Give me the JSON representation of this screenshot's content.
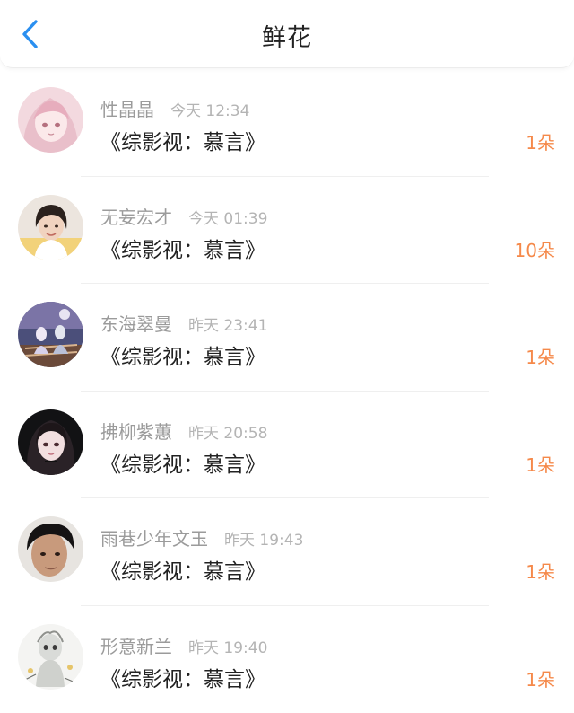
{
  "header": {
    "title": "鲜花",
    "back_icon": "chevron-left-icon",
    "accent": "#2a8ff0"
  },
  "colors": {
    "count": "#f5894a",
    "name": "#9b9b9b",
    "time": "#b4b4b4",
    "book": "#222222"
  },
  "records": [
    {
      "name": "性晶晶",
      "time": "今天 12:34",
      "book": "《综影视：慕言》",
      "count": "1朵",
      "avatar": "pink-anime-girl"
    },
    {
      "name": "无妄宏才",
      "time": "今天 01:39",
      "book": "《综影视：慕言》",
      "count": "10朵",
      "avatar": "smiling-girl-photo"
    },
    {
      "name": "东海翠曼",
      "time": "昨天 23:41",
      "book": "《综影视：慕言》",
      "count": "1朵",
      "avatar": "night-scene-figures"
    },
    {
      "name": "拂柳紫蕙",
      "time": "昨天 20:58",
      "book": "《综影视：慕言》",
      "count": "1朵",
      "avatar": "dark-haired-girl-art"
    },
    {
      "name": "雨巷少年文玉",
      "time": "昨天 19:43",
      "book": "《综影视：慕言》",
      "count": "1朵",
      "avatar": "young-man-photo"
    },
    {
      "name": "形意新兰",
      "time": "昨天 19:40",
      "book": "《综影视：慕言》",
      "count": "1朵",
      "avatar": "sketch-figure-art"
    }
  ]
}
